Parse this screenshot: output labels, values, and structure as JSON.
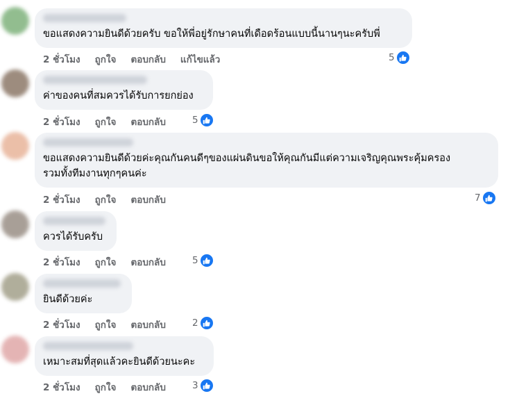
{
  "comments": [
    {
      "text": "ขอแสดงความยินดีด้วยครับ ขอให้พี่อยู่รักษาคนที่เดือดร้อนแบบนี้นานๆนะครับพี่",
      "time": "2 ชั่วโมง",
      "like": "ถูกใจ",
      "reply": "ตอบกลับ",
      "edited": "แก้ไขแล้ว",
      "reactions": "5",
      "avatar_color": "#7fb27c"
    },
    {
      "text": "ค่าของคนที่สมควรได้รับการยกย่อง",
      "time": "2 ชั่วโมง",
      "like": "ถูกใจ",
      "reply": "ตอบกลับ",
      "reactions": "5",
      "avatar_color": "#8c7868"
    },
    {
      "text_lines": [
        "ขอแสดงความยินดีด้วยค่ะคุณกันคนดีๆของแผ่นดินขอให้คุณกันมีแต่ความเจริญคุณพระคุ้มครอง",
        "รวมทั้งทีมงานทุกๆคนค่ะ"
      ],
      "time": "2 ชั่วโมง",
      "like": "ถูกใจ",
      "reply": "ตอบกลับ",
      "reactions": "7",
      "avatar_color": "#e8b49a"
    },
    {
      "text": "ควรได้รับครับ",
      "time": "2 ชั่วโมง",
      "like": "ถูกใจ",
      "reply": "ตอบกลับ",
      "reactions": "5",
      "avatar_color": "#9a8f86"
    },
    {
      "text": "ยินดีด้วยค่ะ",
      "time": "2 ชั่วโมง",
      "like": "ถูกใจ",
      "reply": "ตอบกลับ",
      "reactions": "2",
      "avatar_color": "#a3a08a"
    },
    {
      "text": "เหมาะสมที่สุดแล้วคะยินดีด้วยนะคะ",
      "time": "2 ชั่วโมง",
      "like": "ถูกใจ",
      "reply": "ตอบกลับ",
      "reactions": "3",
      "avatar_color": "#e0a8a8"
    }
  ],
  "colors": {
    "bubble": "#f0f2f5",
    "meta": "#65676b",
    "like_blue": "#1877f2"
  },
  "icons": {
    "reaction": "thumbs-up-icon"
  }
}
